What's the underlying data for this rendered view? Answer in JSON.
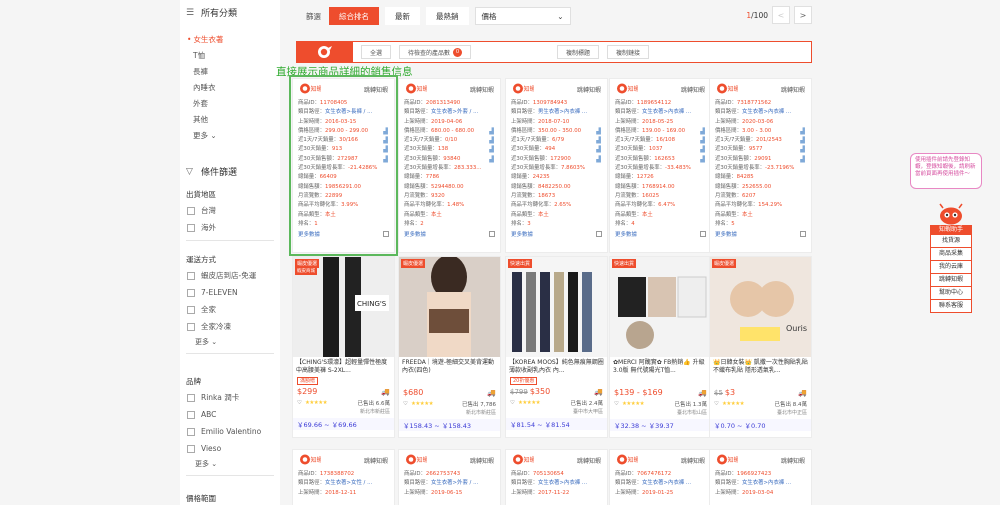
{
  "sidebar": {
    "categories_title": "所有分類",
    "categories": [
      {
        "label": "女生衣著",
        "active": true
      },
      {
        "label": "T恤"
      },
      {
        "label": "長褲"
      },
      {
        "label": "內睡衣"
      },
      {
        "label": "外套"
      },
      {
        "label": "其他"
      }
    ],
    "more": "更多",
    "filter_title": "條件篩選",
    "ship_from_title": "出貨地區",
    "ship_from": [
      "台灣",
      "海外"
    ],
    "shipping_title": "運送方式",
    "shipping": [
      "蝦皮店到店-免運",
      "7-ELEVEN",
      "全家",
      "全家冷凍"
    ],
    "brand_title": "品牌",
    "brands": [
      "Rinka 潤卡",
      "ABC",
      "Emilio Valentino",
      "Vieso"
    ],
    "price_title": "價格範圍"
  },
  "sortbar": {
    "label": "篩選",
    "buttons": [
      "綜合排名",
      "最新",
      "最熱銷"
    ],
    "select_value": "價格",
    "page_current": "1",
    "page_total": "/100",
    "prev": "<",
    "next": ">"
  },
  "toolbar": {
    "btn_all": "全選",
    "btn_selected": "待檢查的產品數",
    "badge": "0",
    "btn_copy_title": "複制標題",
    "btn_copy_link": "複制鏈接"
  },
  "hint": "直接展示商品詳細的銷售信息",
  "card_labels": {
    "jump": "跳轉知蝦",
    "id": "商品ID：",
    "path": "類目路徑：",
    "listed": "上架時間：",
    "price_range": "價格區間：",
    "sales7": "近1天/7天銷量：",
    "sales30": "近30天銷量：",
    "revenue30": "近30天銷售額：",
    "growth30": "近30天銷量增長率：",
    "total_sales": "總銷量：",
    "total_revenue": "總銷售額：",
    "monthly_views": "月流覽數：",
    "conversion": "商品平均轉化率：",
    "type": "商品類型：",
    "rank": "排名：",
    "more": "更多數據"
  },
  "cards": [
    {
      "id": "11708405",
      "path": "女生衣著>長褲 / ...",
      "listed": "2016-03-15",
      "price": "299.00 - 299.00",
      "sales7": "30/166",
      "sales30": "913",
      "revenue30": "272987",
      "growth30": "-21.4286%",
      "total_sales": "66409",
      "total_revenue": "19856291.00",
      "views": "22899",
      "conv": "3.99%",
      "type": "本土",
      "rank": "1"
    },
    {
      "id": "2081313490",
      "path": "女生衣著>外套 / ...",
      "listed": "2019-04-06",
      "price": "680.00 - 680.00",
      "sales7": "0/10",
      "sales30": "138",
      "revenue30": "93840",
      "growth30": "283.333...",
      "total_sales": "7786",
      "total_revenue": "5294480.00",
      "views": "9320",
      "conv": "1.48%",
      "type": "本土",
      "rank": "2"
    },
    {
      "id": "1309784943",
      "path": "男生衣著>內衣褲 ...",
      "listed": "2018-07-10",
      "price": "350.00 - 350.00",
      "sales7": "6/79",
      "sales30": "494",
      "revenue30": "172900",
      "growth30": "7.8603%",
      "total_sales": "24235",
      "total_revenue": "8482250.00",
      "views": "18673",
      "conv": "2.65%",
      "type": "本土",
      "rank": "3"
    },
    {
      "id": "1189654112",
      "path": "女生衣著>內衣褲 ...",
      "listed": "2018-05-25",
      "price": "139.00 - 169.00",
      "sales7": "16/108",
      "sales30": "1037",
      "revenue30": "162653",
      "growth30": "-33.483%",
      "total_sales": "12726",
      "total_revenue": "1768914.00",
      "views": "16025",
      "conv": "6.47%",
      "type": "本土",
      "rank": "4"
    },
    {
      "id": "7318771562",
      "path": "女生衣著>內衣褲 ...",
      "listed": "2020-03-06",
      "price": "3.00 - 3.00",
      "sales7": "201/2543",
      "sales30": "9577",
      "revenue30": "29091",
      "growth30": "-23.7196%",
      "total_sales": "84285",
      "total_revenue": "252655.00",
      "views": "6207",
      "conv": "154.29%",
      "type": "本土",
      "rank": "5"
    }
  ],
  "products": [
    {
      "badge": "蝦皮優選",
      "badge2": "蝦皮商城",
      "title": "【CHING'S環濠】超輕量彈性極度中高腰美褲 S-2XL...",
      "tag": "滿額贈",
      "old_price": "",
      "price": "$299",
      "sold": "已售出 6.6萬",
      "loc": "新北市新莊區",
      "range": "￥69.66 ~ ￥69.66"
    },
    {
      "badge": "蝦皮優選",
      "badge2": "",
      "title": "FREEDA｜境遊-極細交叉美背運動內衣(四色)",
      "tag": "",
      "old_price": "",
      "price": "$680",
      "sold": "已售出 7,786",
      "loc": "新北市新莊區",
      "range": "￥158.43 ~ ￥158.43"
    },
    {
      "badge": "快速出貨",
      "badge2": "",
      "title": "【KOREA MOOS】純色無痕無鋼圈薄款收副乳內衣 內...",
      "tag": "20折優惠",
      "old_price": "$799",
      "price": "$350",
      "sold": "已售出 2.4萬",
      "loc": "臺中市大甲區",
      "range": "￥81.54 ~ ￥81.54"
    },
    {
      "badge": "快速出貨",
      "badge2": "",
      "title": "✿MERCI 阿醜實✿ FB熱銷👍 升級3.0版 無代號陽光T恤...",
      "tag": "",
      "old_price": "",
      "price": "$139 - $169",
      "sold": "已售出 1.3萬",
      "loc": "臺北市松山區",
      "range": "￥32.38 ~ ￥39.37"
    },
    {
      "badge": "蝦皮優選",
      "badge2": "",
      "title": "👑日韓女裝👑 凱撒一次性胸貼乳貼 不織布乳貼 隱形透氣乳...",
      "tag": "",
      "old_price": "$5",
      "price": "$3",
      "sold": "已售出 8.4萬",
      "loc": "臺北市中正區",
      "range": "￥0.70 ~ ￥0.70"
    }
  ],
  "cards2": [
    {
      "id": "1738388702",
      "path": "女生衣著>女性 / ...",
      "listed": "2018-12-11"
    },
    {
      "id": "2662753743",
      "path": "女生衣著>外套 / ...",
      "listed": "2019-06-15"
    },
    {
      "id": "705130654",
      "path": "女生衣著>內衣褲 ...",
      "listed": "2017-11-22"
    },
    {
      "id": "7067476172",
      "path": "女生衣著>內衣褲 ...",
      "listed": "2019-01-25"
    },
    {
      "id": "1966927423",
      "path": "女生衣著>內衣褲 ...",
      "listed": "2019-03-04"
    }
  ],
  "tip": "使用插件前請先登錄知蝦，登錄知蝦後，請刷新當前頁面再使用插件～",
  "helper": {
    "title": "知蝦助手",
    "items": [
      "找貨源",
      "商品采集",
      "我的云庫",
      "跳轉知蝦",
      "幫助中心",
      "聯系客服"
    ]
  },
  "colors": {
    "brand": "#ee4d2d",
    "hint_green": "#2eaa2e",
    "link_blue": "#3b6dbf"
  }
}
